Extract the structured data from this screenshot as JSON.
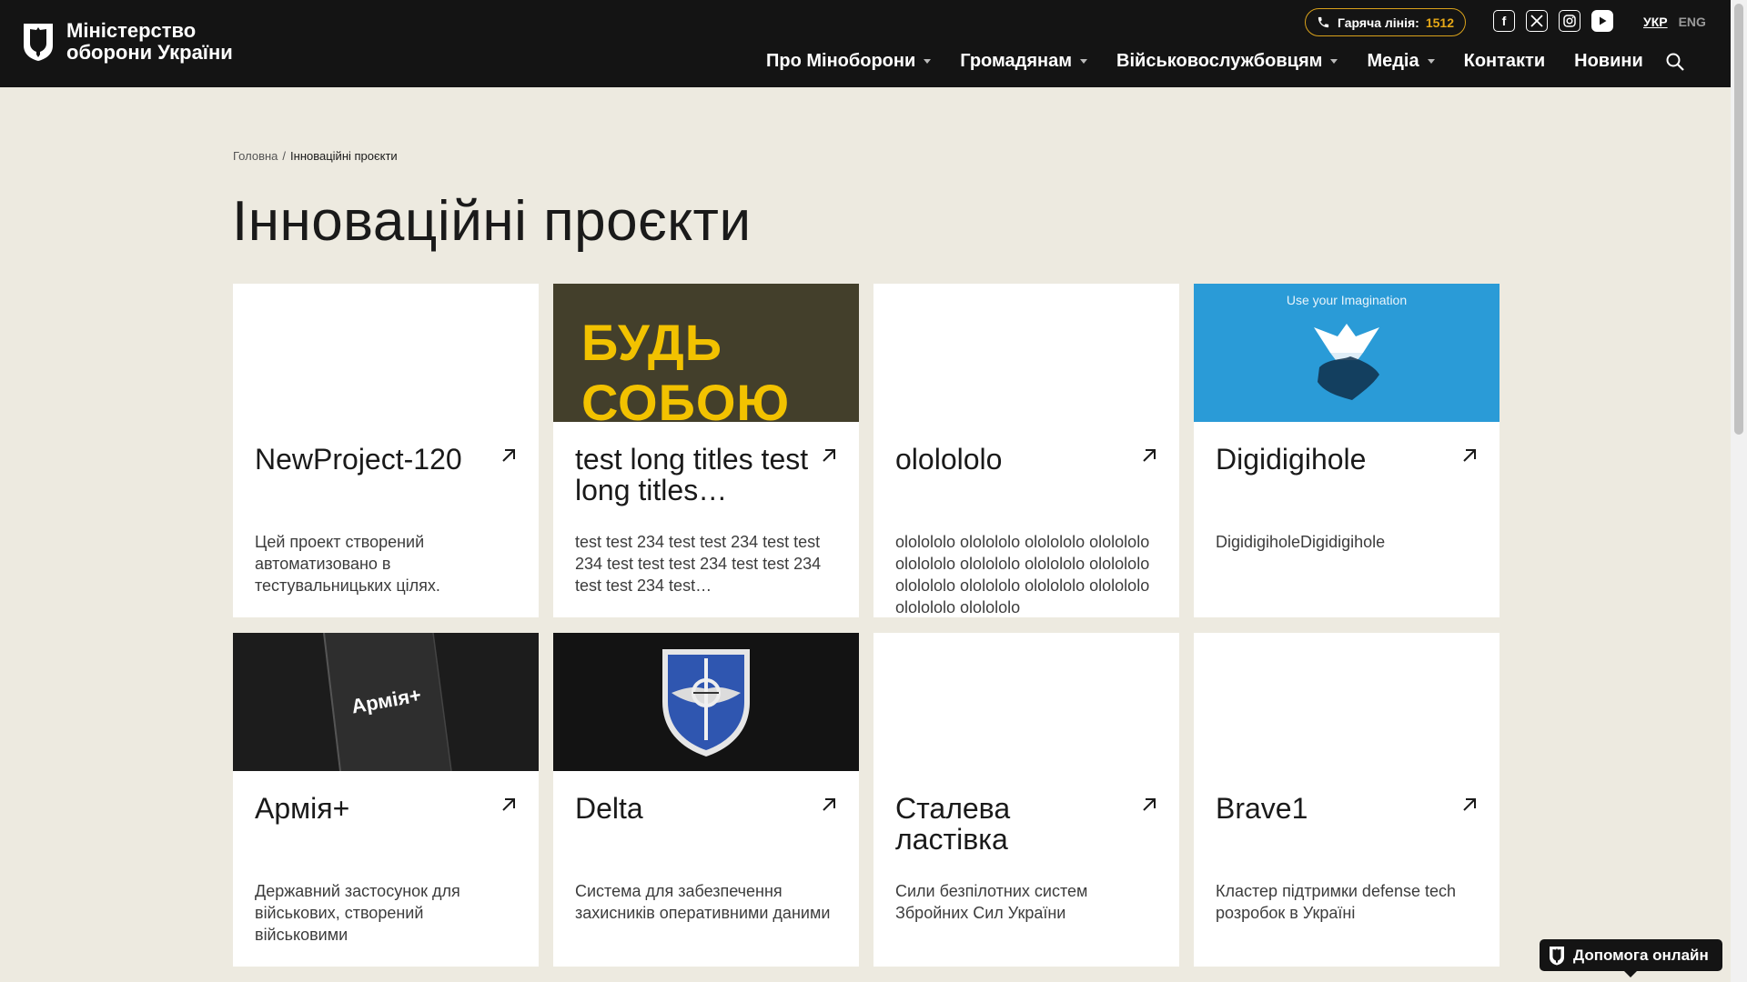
{
  "header": {
    "logo_line1": "Міністерство",
    "logo_line2": "оборони України",
    "hotline_label": "Гаряча лінія:",
    "hotline_number": "1512",
    "socials": [
      "facebook-icon",
      "x-icon",
      "instagram-icon",
      "youtube-icon"
    ],
    "lang_active": "УКР",
    "lang_other": "ENG",
    "nav": [
      {
        "label": "Про Міноборони",
        "dropdown": true
      },
      {
        "label": "Громадянам",
        "dropdown": true
      },
      {
        "label": "Військовослужбовцям",
        "dropdown": true
      },
      {
        "label": "Медіа",
        "dropdown": true
      },
      {
        "label": "Контакти",
        "dropdown": false
      },
      {
        "label": "Новини",
        "dropdown": false
      }
    ]
  },
  "breadcrumb": {
    "home": "Головна",
    "separator": "/",
    "current": "Інноваційні проєкти"
  },
  "page_title": "Інноваційні проєкти",
  "cards": [
    {
      "title": "NewProject-120",
      "desc": "Цей проект створений автоматизовано в тестувальницьких цілях.",
      "image": "none"
    },
    {
      "title": "test long titles test long titles…",
      "desc": "test test 234 test test 234 test test 234 test test test 234 test test 234 test test 234 test…",
      "image": "budy-soboyu",
      "image_text": "БУДЬ СОБОЮ"
    },
    {
      "title": "ololololo",
      "desc": "ololololo ololololo ololololo ololololo ololololo ololololo ololololo ololololo ololololo ololololo ololololo ololololo ololololo ololololo",
      "image": "none"
    },
    {
      "title": "Digidigihole",
      "desc": "DigidigiholeDigidigihole",
      "image": "imagination",
      "image_text": "Use your Imagination"
    },
    {
      "title": "Армія+",
      "desc": "Державний застосунок для військових, створений військовими",
      "image": "armia",
      "image_text": "Армія+"
    },
    {
      "title": "Delta",
      "desc": "Система для забезпечення захисників оперативними даними",
      "image": "delta"
    },
    {
      "title": "Сталева ластівка",
      "desc": "Сили безпілотних систем Збройних Сил України",
      "image": "none"
    },
    {
      "title": "Brave1",
      "desc": "Кластер підтримки defense tech розробок в Україні",
      "image": "none"
    }
  ],
  "help_button": "Допомога онлайн",
  "colors": {
    "header_bg": "#141414",
    "page_bg": "#edeae0",
    "accent": "#e6a817",
    "card_bg": "#ffffff"
  }
}
